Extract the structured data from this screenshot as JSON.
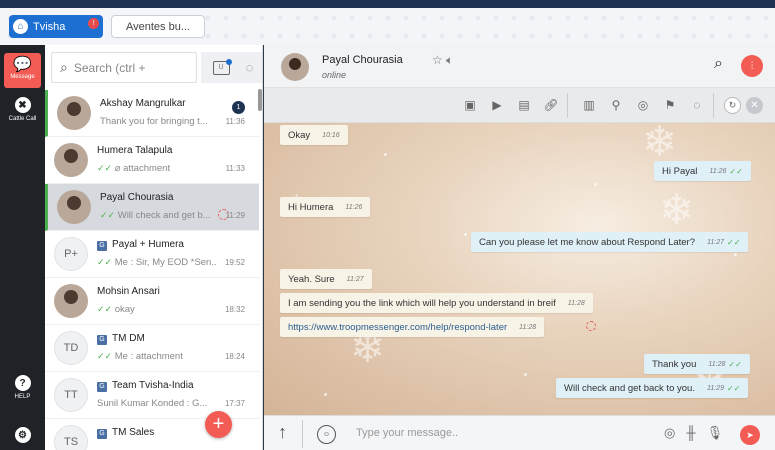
{
  "orgs": [
    {
      "name": "Tvisha",
      "badge": "!"
    },
    {
      "name": "Aventes bu..."
    }
  ],
  "rail": {
    "message_label": "Message",
    "cattle_label": "Cattle Call",
    "help_label": "HELP"
  },
  "sidebar": {
    "search_placeholder": "Search (ctrl +",
    "unread_filter_label": "U",
    "new_chat_button": "+",
    "contacts": [
      {
        "name": "Akshay Mangrulkar",
        "message": "Thank you for bringing t...",
        "time": "11:36",
        "unread": "1",
        "avatar": "photo"
      },
      {
        "name": "Humera Talapula",
        "message": "attachment",
        "time": "11:33",
        "avatar": "photo"
      },
      {
        "name": "Payal Chourasia",
        "message": "Will check and get b...",
        "time": "11:29",
        "avatar": "photo"
      },
      {
        "name": "Payal + Humera",
        "message": "Me : Sir, My EOD *Sen...",
        "time": "19:52",
        "initials": "P+",
        "group": true
      },
      {
        "name": "Mohsin Ansari",
        "message": "okay",
        "time": "18:32",
        "avatar": "photo"
      },
      {
        "name": "TM DM",
        "message": "Me : attachment",
        "time": "18:24",
        "initials": "TD",
        "group": true
      },
      {
        "name": "Team Tvisha-India",
        "message": "Sunil Kumar Konded : G...",
        "time": "17:37",
        "initials": "TT",
        "group": true
      },
      {
        "name": "TM Sales",
        "message": "",
        "time": "",
        "initials": "TS",
        "group": true
      }
    ]
  },
  "chat": {
    "name": "Payal Chourasia",
    "status": "online",
    "composer_placeholder": "Type your message..",
    "messages": [
      {
        "dir": "in",
        "text": "Okay",
        "time": "10:16"
      },
      {
        "dir": "out",
        "text": "Hi Payal",
        "time": "11:26"
      },
      {
        "dir": "in",
        "text": "Hi Humera",
        "time": "11:26"
      },
      {
        "dir": "out",
        "text": "Can you please let me know about Respond Later?",
        "time": "11:27"
      },
      {
        "dir": "in",
        "text": "Yeah. Sure",
        "time": "11:27"
      },
      {
        "dir": "in",
        "text": "I am sending you the link which will help you understand in breif",
        "time": "11:28"
      },
      {
        "dir": "in",
        "text": "https://www.troopmessenger.com/help/respond-later",
        "time": "11:28"
      },
      {
        "dir": "out",
        "text": "Thank you",
        "time": "11:28"
      },
      {
        "dir": "out",
        "text": "Will check and get back to you.",
        "time": "11:29"
      }
    ]
  },
  "colors": {
    "accent": "#f25c54",
    "brand": "#1e3352",
    "read_tick": "#4caf50"
  }
}
